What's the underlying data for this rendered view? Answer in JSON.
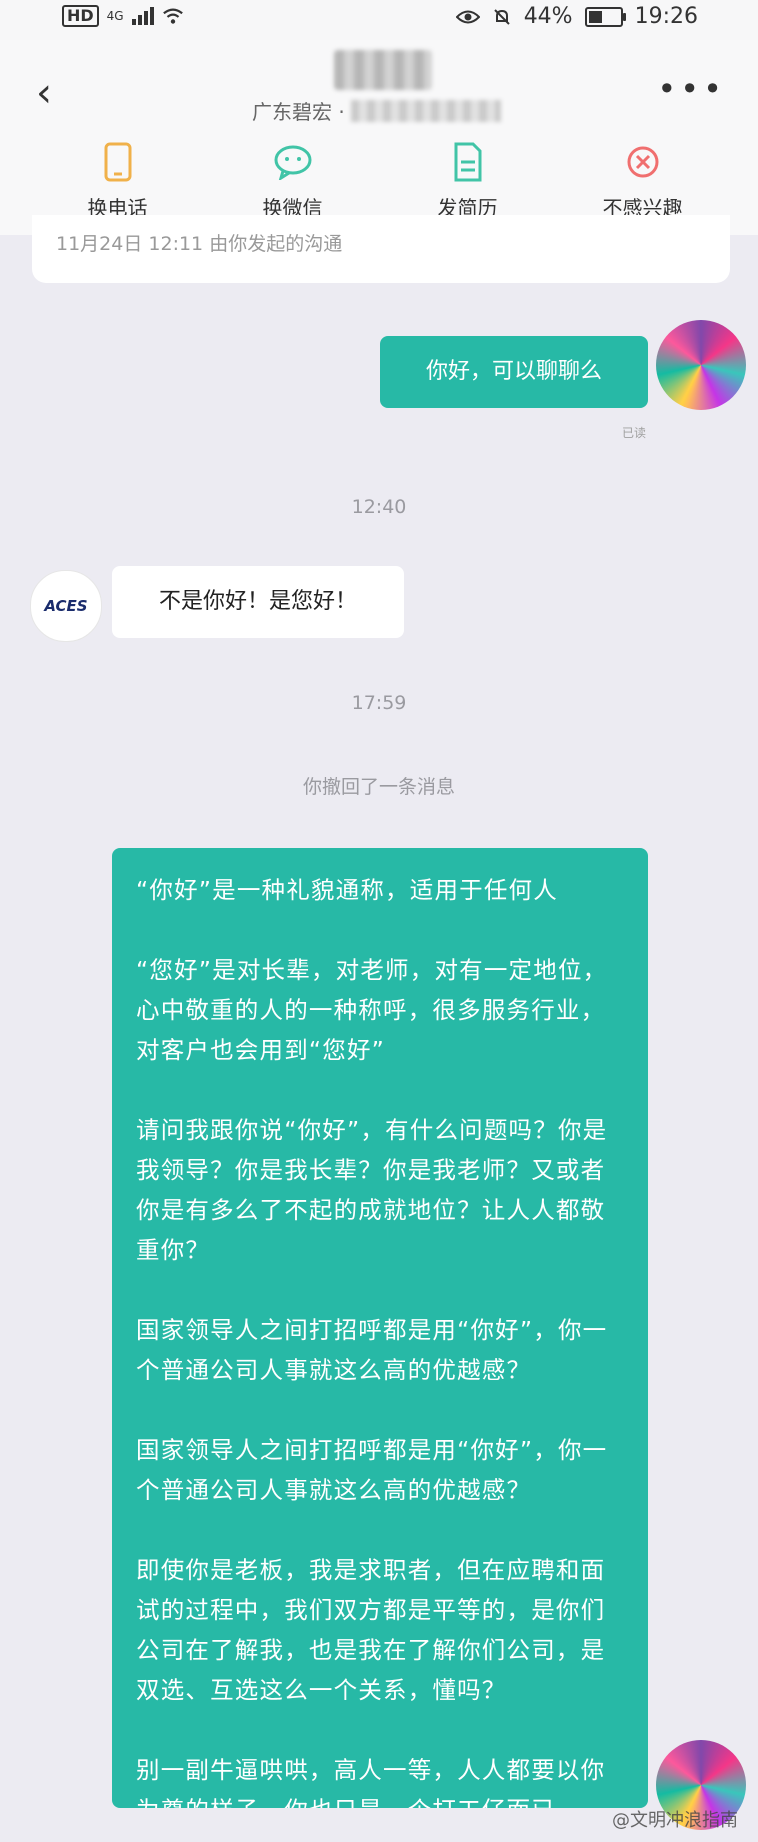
{
  "status_bar": {
    "left": "HD",
    "network": "4G",
    "battery": "44%",
    "battery_level": 0.44,
    "time": "19:26"
  },
  "header": {
    "company_prefix": "广东碧宏 ·",
    "actions": [
      {
        "label": "换电话",
        "icon": "phone-icon",
        "color": "#f0b14a"
      },
      {
        "label": "换微信",
        "icon": "wechat-icon",
        "color": "#41c4a7"
      },
      {
        "label": "发简历",
        "icon": "resume-icon",
        "color": "#41c4a7"
      },
      {
        "label": "不感兴趣",
        "icon": "close-circle-icon",
        "color": "#f06f6f"
      }
    ]
  },
  "meta": {
    "text": "11月24日 12:11 由你发起的沟通"
  },
  "messages": {
    "msg1": "你好，可以聊聊么",
    "read": "已读",
    "time1": "12:40",
    "msg2": "不是你好！是您好！",
    "time2": "17:59",
    "notice": "你撤回了一条消息",
    "long_paragraphs": [
      "“你好”是一种礼貌通称，适用于任何人",
      "“您好”是对长辈，对老师，对有一定地位，心中敬重的人的一种称呼，很多服务行业，对客户也会用到“您好”",
      "请问我跟你说“你好”，有什么问题吗？你是我领导？你是我长辈？你是我老师？又或者你是有多么了不起的成就地位？让人人都敬重你？",
      "国家领导人之间打招呼都是用“你好”，你一个普通公司人事就这么高的优越感？",
      "国家领导人之间打招呼都是用“你好”，你一个普通公司人事就这么高的优越感？",
      "即使你是老板，我是求职者，但在应聘和面试的过程中，我们双方都是平等的，是你们公司在了解我，也是我在了解你们公司，是双选、互选这么一个关系，懂吗？",
      "别一副牛逼哄哄，高人一等，人人都要以你为尊的样子，你也只是一个打工仔而已"
    ]
  },
  "other_avatar_text": "ACES",
  "watermark": "@文明冲浪指南",
  "colors": {
    "accent": "#27b9a6",
    "chat_bg": "#ecebf2"
  }
}
